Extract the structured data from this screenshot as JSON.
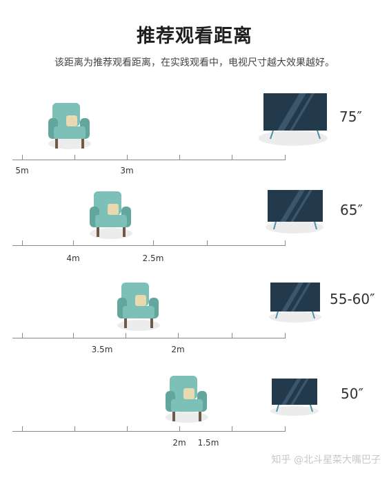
{
  "header": {
    "title": "推荐观看距离",
    "subtitle": "该距离为推荐观看距离，在实践观看中，电视尺寸越大效果越好。"
  },
  "rows": [
    {
      "tv_size": "75″",
      "near_label": "5m",
      "far_label": "3m"
    },
    {
      "tv_size": "65″",
      "near_label": "4m",
      "far_label": "2.5m"
    },
    {
      "tv_size": "55-60″",
      "near_label": "3.5m",
      "far_label": "2m"
    },
    {
      "tv_size": "50″",
      "near_label": "2m",
      "far_label": "1.5m"
    }
  ],
  "watermark": "知乎 @北斗星菜大嘴巴子",
  "colors": {
    "chair": "#7cc0b8",
    "chair_dark": "#62a69e",
    "cushion": "#e8d9b0",
    "tv_screen": "#233a4d",
    "axis": "#8a8a8a"
  }
}
